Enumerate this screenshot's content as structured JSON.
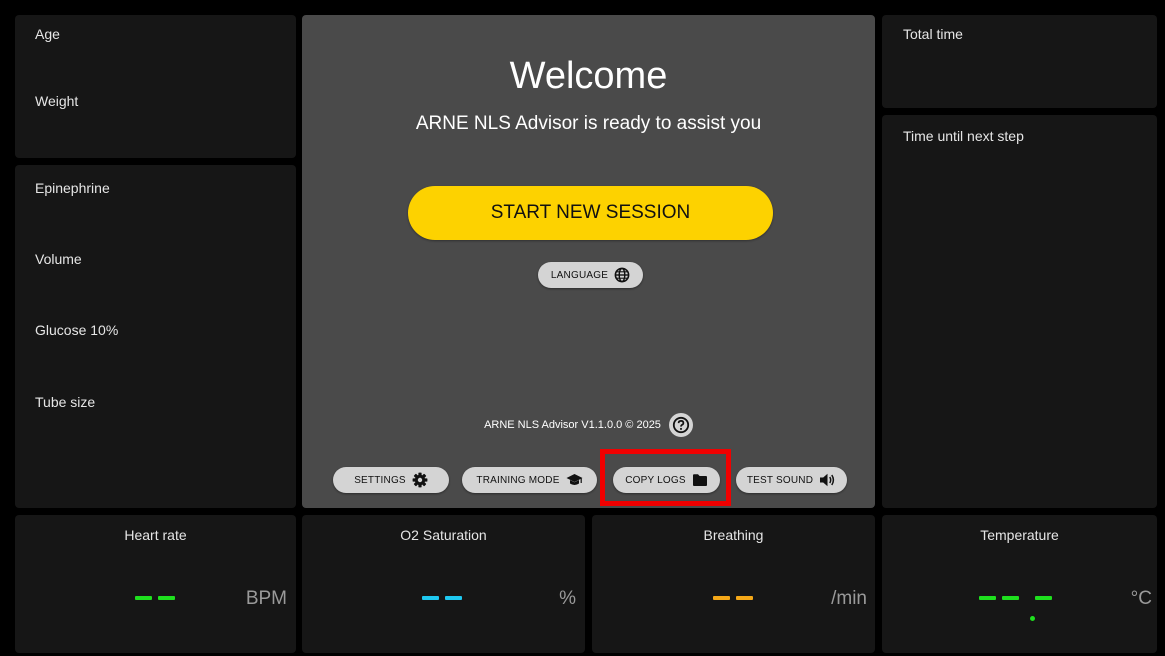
{
  "patient": {
    "age_label": "Age",
    "weight_label": "Weight"
  },
  "medication": {
    "epinephrine_label": "Epinephrine",
    "volume_label": "Volume",
    "glucose_label": "Glucose 10%",
    "tube_label": "Tube size"
  },
  "center": {
    "title": "Welcome",
    "subtitle": "ARNE NLS Advisor is ready to assist you",
    "start_label": "START NEW SESSION",
    "language_label": "LANGUAGE",
    "version_text": "ARNE NLS Advisor V1.1.0.0 © 2025",
    "buttons": {
      "settings": "SETTINGS",
      "training": "TRAINING MODE",
      "copy_logs": "COPY LOGS",
      "test_sound": "TEST SOUND"
    },
    "accent_color": "#fdd200",
    "highlight_color": "#f00000"
  },
  "timers": {
    "total_label": "Total time",
    "next_label": "Time until next step"
  },
  "vitals": {
    "heart_rate": {
      "title": "Heart rate",
      "unit": "BPM",
      "color": "#1ee01e"
    },
    "o2": {
      "title": "O2 Saturation",
      "unit": "%",
      "color": "#1ec8f0"
    },
    "breathing": {
      "title": "Breathing",
      "unit": "/min",
      "color": "#f5a818"
    },
    "temperature": {
      "title": "Temperature",
      "unit": "°C",
      "color": "#1ee01e"
    }
  }
}
